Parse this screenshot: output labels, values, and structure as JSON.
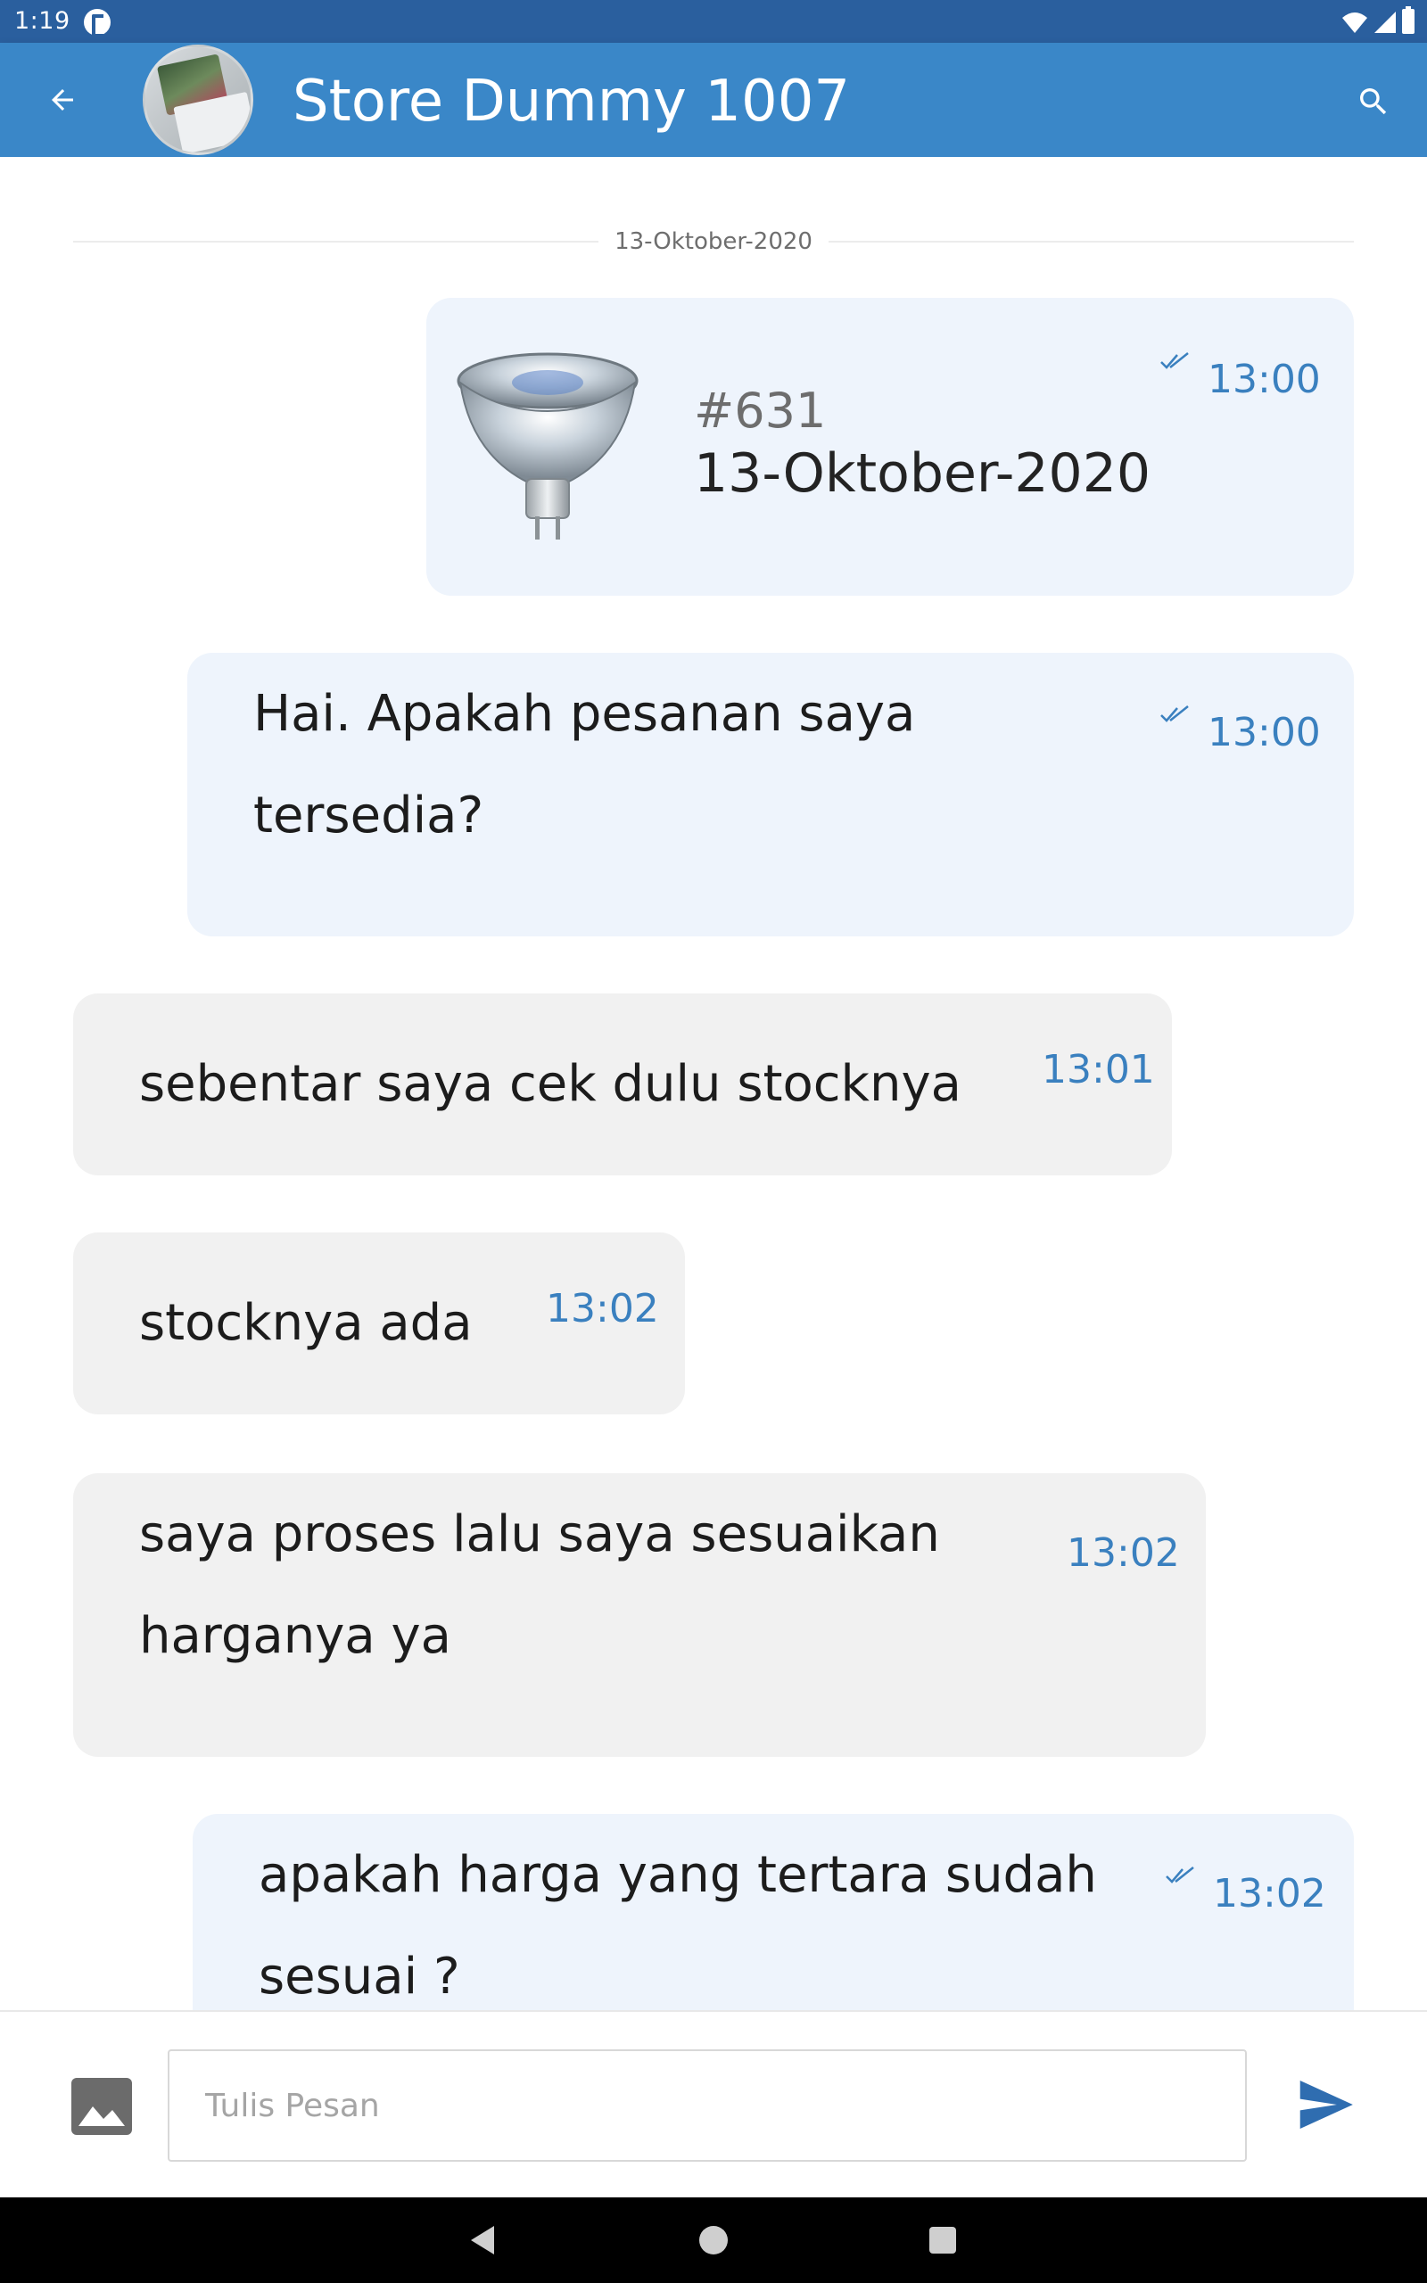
{
  "status_bar": {
    "time": "1:19"
  },
  "header": {
    "title": "Store Dummy 1007"
  },
  "chat": {
    "date_divider": "13-Oktober-2020",
    "order_card": {
      "order_number": "#631",
      "order_date": "13-Oktober-2020",
      "time": "13:00",
      "image_icon": "halogen-bulb-image"
    },
    "messages": [
      {
        "text": "Hai. Apakah pesanan saya tersedia?",
        "time": "13:00",
        "direction": "outgoing"
      },
      {
        "text": "sebentar saya cek dulu stocknya",
        "time": "13:01",
        "direction": "incoming"
      },
      {
        "text": "stocknya ada",
        "time": "13:02",
        "direction": "incoming"
      },
      {
        "text": "saya proses lalu saya sesuaikan harganya ya",
        "time": "13:02",
        "direction": "incoming"
      },
      {
        "text": "apakah harga yang tertara sudah sesuai ?",
        "time": "13:02",
        "direction": "outgoing"
      }
    ]
  },
  "composer": {
    "placeholder": "Tulis Pesan",
    "attach_icon": "image-icon",
    "send_icon": "send-icon"
  },
  "colors": {
    "primary": "#3a87c8",
    "status_bar": "#2a5f9e",
    "outgoing_bubble": "#eef4fc",
    "incoming_bubble": "#f1f1f1",
    "time_text": "#3a80bf"
  }
}
